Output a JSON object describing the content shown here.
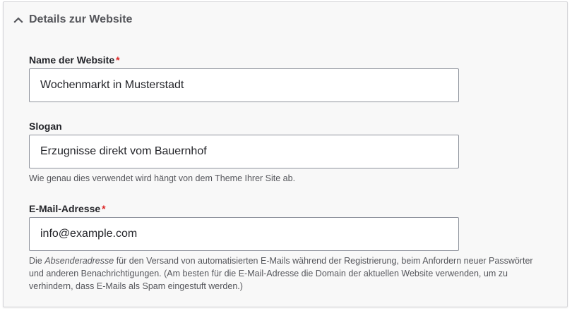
{
  "section": {
    "title": "Details zur Website",
    "expanded": true,
    "toggle_icon": "chevron-up-icon"
  },
  "fields": {
    "site_name": {
      "label": "Name der Website",
      "required_marker": "*",
      "value": "Wochenmarkt in Musterstadt"
    },
    "slogan": {
      "label": "Slogan",
      "value": "Erzugnisse direkt vom Bauernhof",
      "description": "Wie genau dies verwendet wird hängt von dem Theme Ihrer Site ab."
    },
    "email": {
      "label": "E-Mail-Adresse",
      "required_marker": "*",
      "value": "info@example.com",
      "description_prefix": "Die ",
      "description_emphasis": "Absenderadresse",
      "description_suffix": " für den Versand von automatisierten E-Mails während der Registrierung, beim Anfordern neuer Passwörter und anderen Benachrichtigungen. (Am besten für die E-Mail-Adresse die Domain der aktuellen Website verwenden, um zu verhindern, dass E-Mails als Spam eingestuft werden.)"
    }
  },
  "colors": {
    "required": "#dc2323",
    "text": "#232429",
    "muted": "#55565b",
    "input_border": "#8e929c",
    "panel_background": "#f8f8f8"
  }
}
